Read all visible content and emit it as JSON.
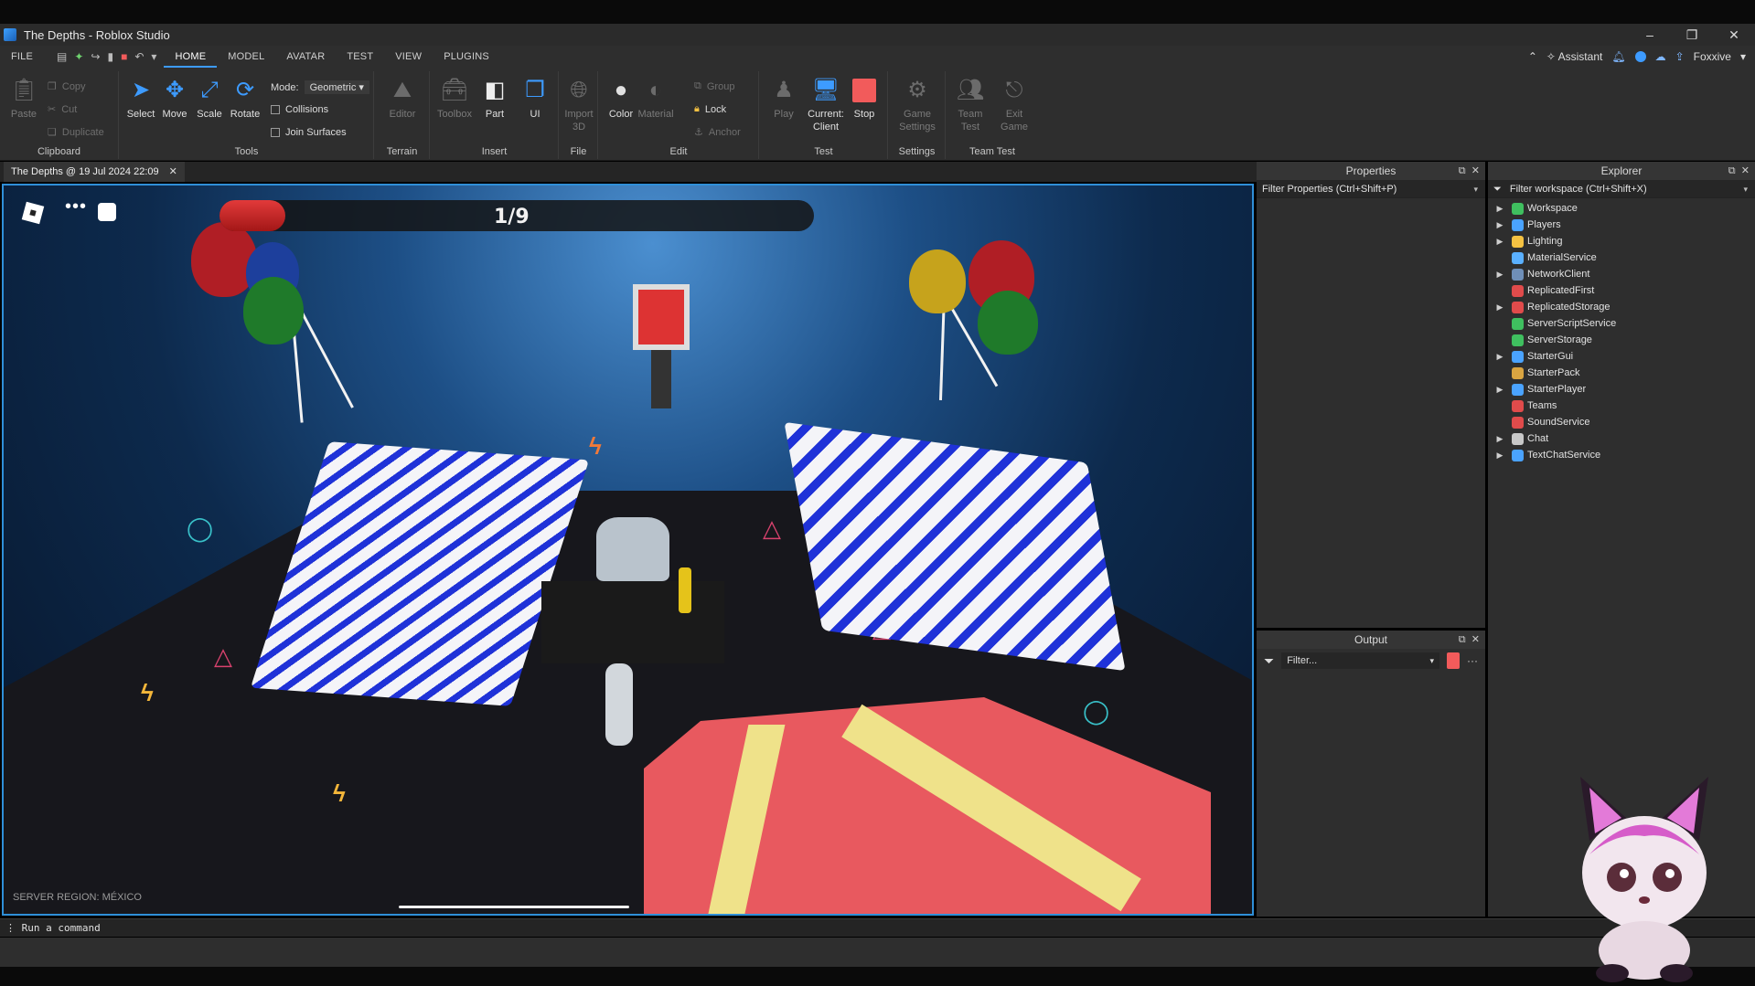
{
  "window": {
    "title": "The Depths - Roblox Studio",
    "controls": [
      "–",
      "❐",
      "✕"
    ]
  },
  "menubar": {
    "file": "FILE",
    "tabs": [
      "HOME",
      "MODEL",
      "AVATAR",
      "TEST",
      "VIEW",
      "PLUGINS"
    ],
    "active_tab": "HOME",
    "assistant": "Assistant",
    "user": "Foxxive"
  },
  "ribbon": {
    "clipboard": {
      "label": "Clipboard",
      "paste": "Paste",
      "copy": "Copy",
      "cut": "Cut",
      "duplicate": "Duplicate"
    },
    "tools": {
      "label": "Tools",
      "select": "Select",
      "move": "Move",
      "scale": "Scale",
      "rotate": "Rotate",
      "mode_label": "Mode:",
      "mode_value": "Geometric",
      "collisions": "Collisions",
      "join_surfaces": "Join Surfaces"
    },
    "terrain": {
      "label": "Terrain",
      "editor": "Editor"
    },
    "insert": {
      "label": "Insert",
      "toolbox": "Toolbox",
      "part": "Part",
      "ui": "UI"
    },
    "file": {
      "label": "File",
      "import3d": "Import 3D"
    },
    "edit": {
      "label": "Edit",
      "color": "Color",
      "material": "Material",
      "group": "Group",
      "lock": "Lock",
      "anchor": "Anchor"
    },
    "test": {
      "label": "Test",
      "play": "Play",
      "current_client": "Current: Client",
      "stop": "Stop"
    },
    "settings": {
      "label": "Settings",
      "game_settings": "Game Settings"
    },
    "team_test": {
      "label": "Team Test",
      "team_test": "Team Test",
      "exit_game": "Exit Game"
    }
  },
  "doc_tab": {
    "title": "The Depths @ 19 Jul 2024 22:09",
    "close": "✕"
  },
  "viewport": {
    "progress_text": "1/9",
    "progress_fraction": 0.111,
    "server_region": "SERVER REGION: MÉXICO"
  },
  "properties": {
    "title": "Properties",
    "filter_placeholder": "Filter Properties (Ctrl+Shift+P)"
  },
  "output": {
    "title": "Output",
    "filter_placeholder": "Filter..."
  },
  "explorer": {
    "title": "Explorer",
    "filter_placeholder": "Filter workspace (Ctrl+Shift+X)",
    "items": [
      {
        "label": "Workspace",
        "expandable": true,
        "color": "#3fbf5f"
      },
      {
        "label": "Players",
        "expandable": true,
        "color": "#4aa3ff"
      },
      {
        "label": "Lighting",
        "expandable": true,
        "color": "#f5c242"
      },
      {
        "label": "MaterialService",
        "expandable": false,
        "color": "#5ab0ff"
      },
      {
        "label": "NetworkClient",
        "expandable": true,
        "color": "#6f8fb8"
      },
      {
        "label": "ReplicatedFirst",
        "expandable": false,
        "color": "#e04b4b"
      },
      {
        "label": "ReplicatedStorage",
        "expandable": true,
        "color": "#e04b4b"
      },
      {
        "label": "ServerScriptService",
        "expandable": false,
        "color": "#3fbf5f"
      },
      {
        "label": "ServerStorage",
        "expandable": false,
        "color": "#3fbf5f"
      },
      {
        "label": "StarterGui",
        "expandable": true,
        "color": "#4aa3ff"
      },
      {
        "label": "StarterPack",
        "expandable": false,
        "color": "#d9a441"
      },
      {
        "label": "StarterPlayer",
        "expandable": true,
        "color": "#4aa3ff"
      },
      {
        "label": "Teams",
        "expandable": false,
        "color": "#e04b4b"
      },
      {
        "label": "SoundService",
        "expandable": false,
        "color": "#e04b4b"
      },
      {
        "label": "Chat",
        "expandable": true,
        "color": "#c8c8c8"
      },
      {
        "label": "TextChatService",
        "expandable": true,
        "color": "#4aa3ff"
      }
    ]
  },
  "command_bar": {
    "placeholder": "Run a command"
  }
}
